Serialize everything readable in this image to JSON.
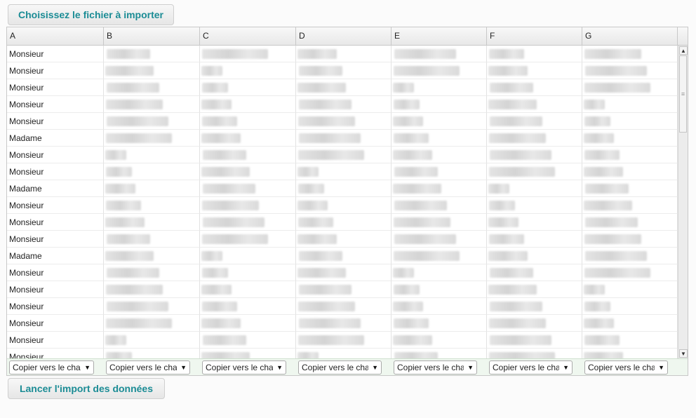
{
  "toolbar": {
    "choose_file_label": "Choisissez le fichier à importer",
    "launch_import_label": "Lancer l'import des données"
  },
  "grid": {
    "columns": [
      "A",
      "B",
      "C",
      "D",
      "E",
      "F",
      "G"
    ],
    "column_a_values": [
      "Monsieur",
      "Monsieur",
      "Monsieur",
      "Monsieur",
      "Monsieur",
      "Madame",
      "Monsieur",
      "Monsieur",
      "Madame",
      "Monsieur",
      "Monsieur",
      "Monsieur",
      "Madame",
      "Monsieur",
      "Monsieur",
      "Monsieur",
      "Monsieur",
      "Monsieur",
      "Monsieur"
    ],
    "copy_select_label": "Copier vers le cha"
  },
  "icons": {
    "dropdown": "chevron-down-icon",
    "scroll_up": "scroll-up-icon",
    "scroll_down": "scroll-down-icon"
  },
  "colors": {
    "button_text": "#1b8c95",
    "select_bar_bg": "#eff7ef"
  }
}
